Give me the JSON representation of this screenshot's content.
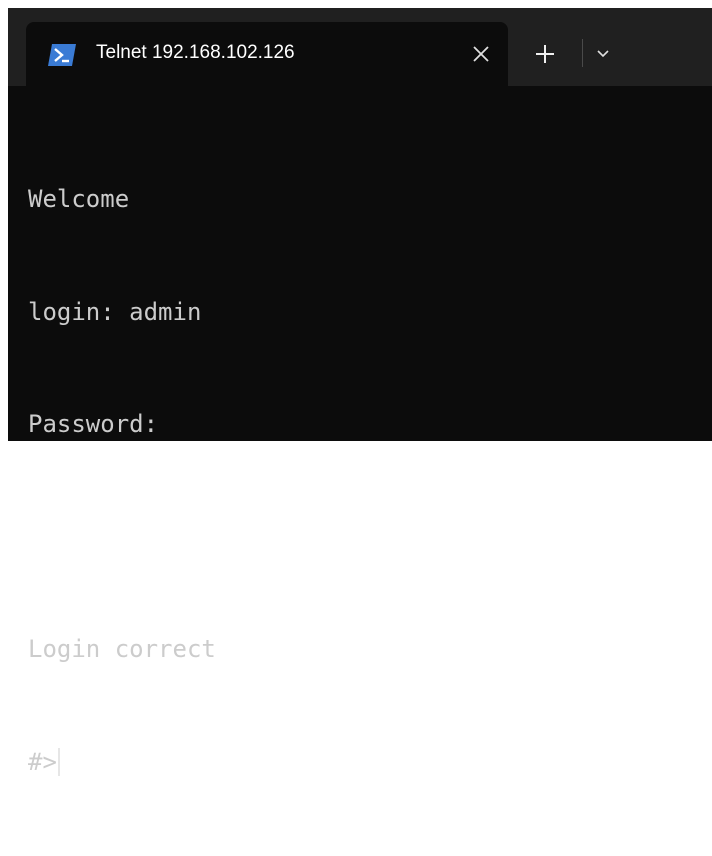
{
  "window": {
    "tab_title": "Telnet 192.168.102.126",
    "tab_icon": "powershell-icon",
    "close_icon": "close-icon",
    "new_tab_icon": "plus-icon",
    "dropdown_icon": "chevron-down-icon"
  },
  "terminal": {
    "lines": [
      "Welcome",
      "login: admin",
      "Password:",
      "",
      "Login correct"
    ],
    "prompt": "#>"
  },
  "colors": {
    "terminal_background": "#0c0c0c",
    "titlebar_background": "#202020",
    "terminal_text": "#cccccc",
    "icon_blue": "#3a7bd5"
  }
}
